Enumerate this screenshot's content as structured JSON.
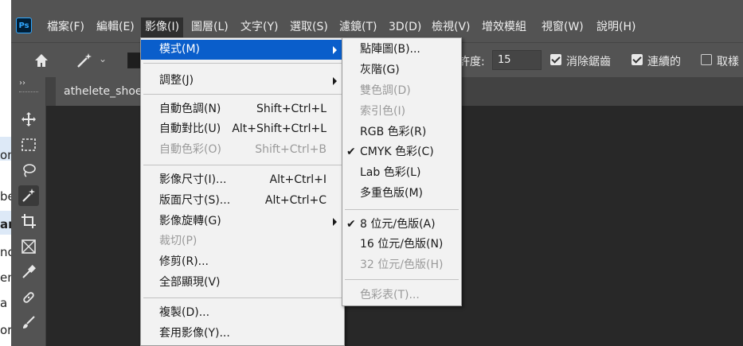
{
  "menubar": {
    "app_icon": "Ps",
    "items": [
      {
        "label": "檔案(F)"
      },
      {
        "label": "編輯(E)"
      },
      {
        "label": "影像(I)"
      },
      {
        "label": "圖層(L)"
      },
      {
        "label": "文字(Y)"
      },
      {
        "label": "選取(S)"
      },
      {
        "label": "濾鏡(T)"
      },
      {
        "label": "3D(D)"
      },
      {
        "label": "檢視(V)"
      },
      {
        "label": "增效模組"
      },
      {
        "label": "視窗(W)"
      },
      {
        "label": "說明(H)"
      }
    ]
  },
  "options": {
    "tolerance_label": "許度:",
    "tolerance_value": "15",
    "anti_alias_label": "消除鋸齒",
    "anti_alias_checked": true,
    "contiguous_label": "連續的",
    "contiguous_checked": true,
    "sample_all_label": "取樣",
    "sample_all_checked": false
  },
  "document": {
    "tab_title": "athelete_shoes"
  },
  "toolbar": {
    "collapse_glyph": "››",
    "tools": [
      "move-tool",
      "marquee-tool",
      "lasso-tool",
      "magic-wand-tool",
      "crop-tool",
      "frame-tool",
      "eyedropper-tool",
      "healing-brush-tool",
      "brush-tool"
    ]
  },
  "left_page": {
    "fragments": [
      "on",
      "be",
      "ar",
      "no",
      "en",
      "a",
      "or"
    ]
  },
  "image_menu": {
    "items": [
      {
        "label": "模式(M)",
        "shortcut": "",
        "submenu": true,
        "disabled": false,
        "highlighted": true
      },
      {
        "label": "調整(J)",
        "shortcut": "",
        "submenu": true,
        "disabled": false
      },
      {
        "label": "自動色調(N)",
        "shortcut": "Shift+Ctrl+L",
        "disabled": false
      },
      {
        "label": "自動對比(U)",
        "shortcut": "Alt+Shift+Ctrl+L",
        "disabled": false
      },
      {
        "label": "自動色彩(O)",
        "shortcut": "Shift+Ctrl+B",
        "disabled": true
      },
      {
        "label": "影像尺寸(I)...",
        "shortcut": "Alt+Ctrl+I",
        "disabled": false
      },
      {
        "label": "版面尺寸(S)...",
        "shortcut": "Alt+Ctrl+C",
        "disabled": false
      },
      {
        "label": "影像旋轉(G)",
        "shortcut": "",
        "submenu": true,
        "disabled": false
      },
      {
        "label": "裁切(P)",
        "shortcut": "",
        "disabled": true
      },
      {
        "label": "修剪(R)...",
        "shortcut": "",
        "disabled": false
      },
      {
        "label": "全部顯現(V)",
        "shortcut": "",
        "disabled": false
      },
      {
        "label": "複製(D)...",
        "shortcut": "",
        "disabled": false
      },
      {
        "label": "套用影像(Y)...",
        "shortcut": "",
        "disabled": false
      }
    ]
  },
  "mode_submenu": {
    "items": [
      {
        "label": "點陣圖(B)...",
        "disabled": false,
        "checked": false
      },
      {
        "label": "灰階(G)",
        "disabled": false,
        "checked": false
      },
      {
        "label": "雙色調(D)",
        "disabled": true,
        "checked": false
      },
      {
        "label": "索引色(I)",
        "disabled": true,
        "checked": false
      },
      {
        "label": "RGB 色彩(R)",
        "disabled": false,
        "checked": false
      },
      {
        "label": "CMYK 色彩(C)",
        "disabled": false,
        "checked": true
      },
      {
        "label": "Lab 色彩(L)",
        "disabled": false,
        "checked": false
      },
      {
        "label": "多重色版(M)",
        "disabled": false,
        "checked": false
      },
      {
        "label": "8 位元/色版(A)",
        "disabled": false,
        "checked": true
      },
      {
        "label": "16 位元/色版(N)",
        "disabled": false,
        "checked": false
      },
      {
        "label": "32 位元/色版(H)",
        "disabled": true,
        "checked": false
      },
      {
        "label": "色彩表(T)...",
        "disabled": true,
        "checked": false
      }
    ],
    "check_glyph": "✔"
  },
  "colors": {
    "highlight": "#0a5ecb",
    "menubar": "#535353",
    "menu_bg": "#f2f2f2",
    "disabled_text": "#9a9a9a"
  }
}
